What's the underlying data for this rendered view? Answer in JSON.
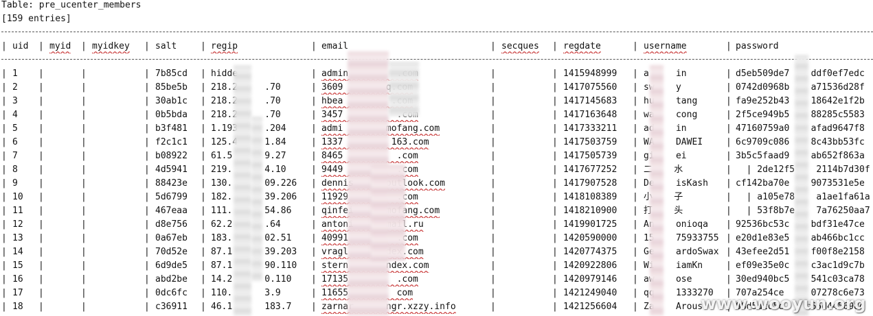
{
  "table_title": "Table: pre_ucenter_members",
  "entries_count": "[159 entries]",
  "separator": "+------+--------+------------+--------+-----------------------+----------------------------------+----------+--------------+----------------+----------------------------------+",
  "columns": [
    "uid",
    "myid",
    "myidkey",
    "salt",
    "regip",
    "email",
    "secques",
    "regdate",
    "username",
    "password"
  ],
  "rows": [
    {
      "uid": "1",
      "salt": "7b85cd",
      "regip": "hidde",
      "email": "admin         .com",
      "regdate": "1415948999",
      "username": "a     in",
      "password": "d5eb509de7    ddf0ef7edc"
    },
    {
      "uid": "2",
      "salt": "85be5b",
      "regip": "218.2     .70",
      "email": "3609        q.com",
      "regdate": "1417075560",
      "username": "sw    y",
      "password": "0742d0968b    a71536d28f"
    },
    {
      "uid": "3",
      "salt": "30ab1c",
      "regip": "218.2     .70",
      "email": "hbea         .com",
      "regdate": "1417145683",
      "username": "hu    tang",
      "password": "fa9e252b43    18642e1f2b"
    },
    {
      "uid": "4",
      "salt": "0b5bda",
      "regip": "218.2     .70",
      "email": "3457          .com",
      "regdate": "1417163648",
      "username": "wa    cong",
      "password": "2f5ce949b5    88285c5583"
    },
    {
      "uid": "5",
      "salt": "b3f481",
      "regip": "1.193     .204",
      "email": "admi        mofang.com",
      "regdate": "1417333211",
      "username": "ad    in",
      "password": "47160759a0    afad9647f8"
    },
    {
      "uid": "6",
      "salt": "f2c1c1",
      "regip": "125.4     1.84",
      "email": "1337         163.com",
      "regdate": "1417503759",
      "username": "WA    DAWEI",
      "password": "6c9709c086    8c43bb53fc"
    },
    {
      "uid": "7",
      "salt": "b08922",
      "regip": "61.5      9.27",
      "email": "8465          .com",
      "regdate": "1417505739",
      "username": "gi    ei",
      "password": "3b5c5faad9    ab652f863a"
    },
    {
      "uid": "8",
      "salt": "4d5941",
      "regip": "219.      4.10",
      "email": "9449          .com",
      "regdate": "1417677252",
      "username": "二    水",
      "password": "  | 2de12f5    2114b7d30f"
    },
    {
      "uid": "9",
      "salt": "88423e",
      "regip": "130.      09.226",
      "email": "dennis      outlook.com",
      "regdate": "1417907528",
      "username": "De    isKash",
      "password": "cf142ba70e    9073531e5e"
    },
    {
      "uid": "10",
      "salt": "5d6799",
      "regip": "182.      39.206",
      "email": "11929         .com",
      "regdate": "1418108389",
      "username": "小    子",
      "password": "  | a105e78    a1ae1fa61a"
    },
    {
      "uid": "11",
      "salt": "467eaa",
      "regip": "111.      54.86",
      "email": "qinfei      mofang.com",
      "regdate": "1418210900",
      "username": "打    头",
      "password": "  | 53f8b7e    7a76250aa7"
    },
    {
      "uid": "12",
      "salt": "d8e756",
      "regip": "62.2      .64",
      "email": "antoni      mail.ru",
      "regdate": "1419901725",
      "username": "An    onioqa",
      "password": "92536bc53c    bdf31e47ce"
    },
    {
      "uid": "13",
      "salt": "0a67eb",
      "regip": "183.      02.51",
      "email": "40991         .com",
      "regdate": "1420590000",
      "username": "15    75933755",
      "password": "e20d1e83e5    ab466bc1cc"
    },
    {
      "uid": "14",
      "salt": "70d52e",
      "regip": "87.1      39.203",
      "email": "vragl       dex.com",
      "regdate": "1420774375",
      "username": "Ge    ardoSwax",
      "password": "43efee2d51    f00f8e2158"
    },
    {
      "uid": "15",
      "salt": "6d9de5",
      "regip": "87.1      90.110",
      "email": "stern       ndex.com",
      "regdate": "1420922806",
      "username": "Wi    iamKn",
      "password": "ef09e35e0c    c3ac1d9c7b"
    },
    {
      "uid": "16",
      "salt": "abd2be",
      "regip": "14.2      0.110",
      "email": "17135         .com",
      "regdate": "1420979146",
      "username": "aw    ose",
      "password": "30ed940bc5    541c03ca78"
    },
    {
      "uid": "17",
      "salt": "0dc6fc",
      "regip": "110.      3.9",
      "email": "11655         com",
      "regdate": "1421249040",
      "username": "qq    1333270",
      "password": "707a254ce     07278c6e73"
    },
    {
      "uid": "18",
      "salt": "c36911",
      "regip": "46.1      183.7",
      "email": "zarnar      ngr.xzzy.info",
      "regdate": "1421256604",
      "username": "Za    Arous",
      "password": "88d5dcd5d    c65d445698d"
    }
  ],
  "watermark": "www.wooyun.org",
  "colors": {
    "background": "#ffffff",
    "text": "#111111",
    "spellcheck_underline": "#cc4444"
  }
}
